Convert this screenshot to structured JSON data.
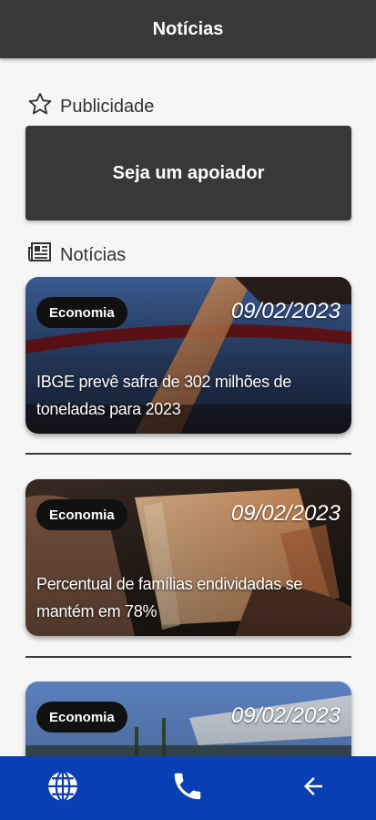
{
  "appbar": {
    "title": "Notícias"
  },
  "ad_section": {
    "icon": "star-outline-icon",
    "label": "Publicidade",
    "banner_text": "Seja um apoiador"
  },
  "news_section": {
    "icon": "newspaper-icon",
    "label": "Notícias",
    "items": [
      {
        "category": "Economia",
        "date": "09/02/2023",
        "title": "IBGE prevê safra de 302 milhões de toneladas para 2023"
      },
      {
        "category": "Economia",
        "date": "09/02/2023",
        "title": "Percentual de famílias endividadas se mantém em 78%"
      },
      {
        "category": "Economia",
        "date": "09/02/2023",
        "title": ""
      }
    ]
  },
  "bottom_nav": {
    "items": [
      {
        "icon": "globe-icon"
      },
      {
        "icon": "phone-icon"
      },
      {
        "icon": "back-arrow-icon"
      }
    ]
  },
  "colors": {
    "appbar": "#383838",
    "bottom_nav": "#0a3eb4",
    "badge": "#111111"
  }
}
